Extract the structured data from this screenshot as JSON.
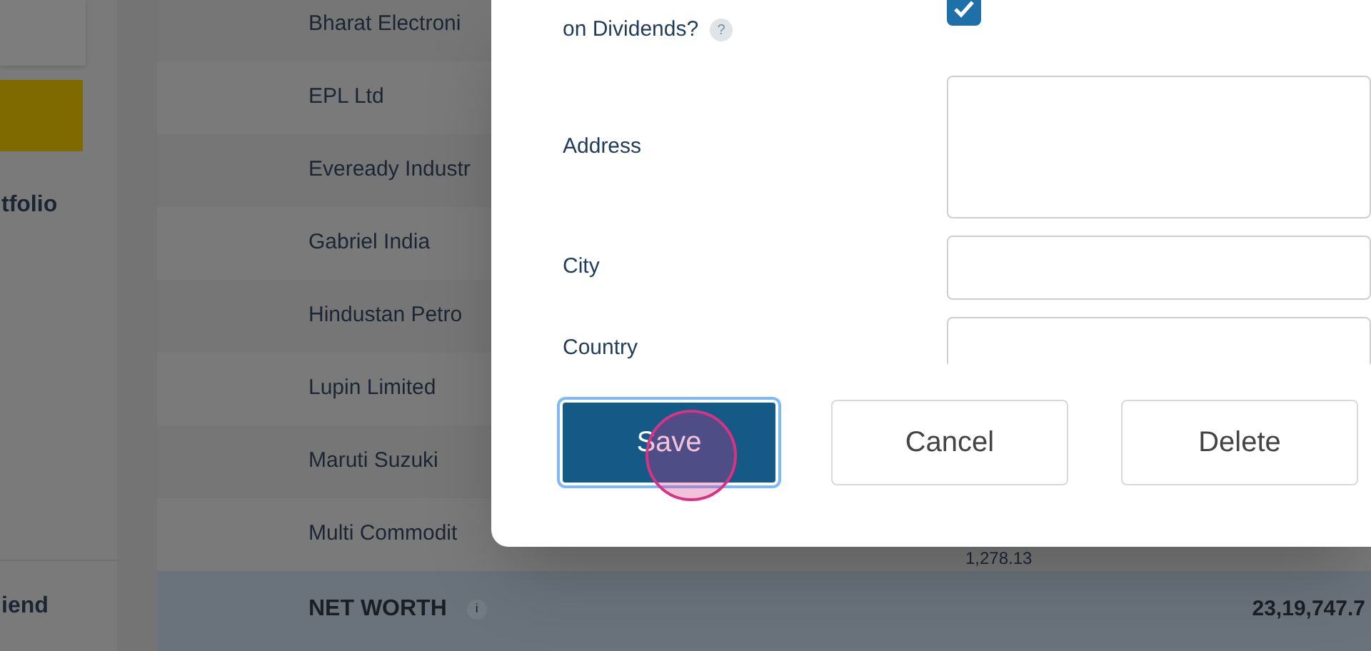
{
  "sidebar": {
    "items": [
      {
        "label": "tfolio",
        "kind": "nav"
      },
      {
        "label": "iend",
        "kind": "footer"
      }
    ]
  },
  "table": {
    "rows": [
      {
        "name": "Bharat Electroni"
      },
      {
        "name": "EPL Ltd"
      },
      {
        "name": "Eveready Industr"
      },
      {
        "name": "Gabriel India"
      },
      {
        "name": "Hindustan Petro"
      },
      {
        "name": "Lupin Limited"
      },
      {
        "name": "Maruti Suzuki"
      },
      {
        "name": "Multi Commodit",
        "column_2": "1,278.13"
      }
    ],
    "total": {
      "label": "NET WORTH",
      "info": "i",
      "value": "23,19,747.7"
    }
  },
  "dialog": {
    "fields": [
      {
        "kind": "checkbox",
        "label": "on Dividends?",
        "help": "?",
        "checked": true
      },
      {
        "kind": "textarea",
        "label": "Address"
      },
      {
        "kind": "text",
        "label": "City"
      },
      {
        "kind": "text",
        "label": "Country"
      }
    ],
    "buttons": [
      {
        "label": "Save",
        "kind": "primary"
      },
      {
        "label": "Cancel",
        "kind": "secondary"
      },
      {
        "label": "Delete",
        "kind": "secondary"
      }
    ]
  }
}
